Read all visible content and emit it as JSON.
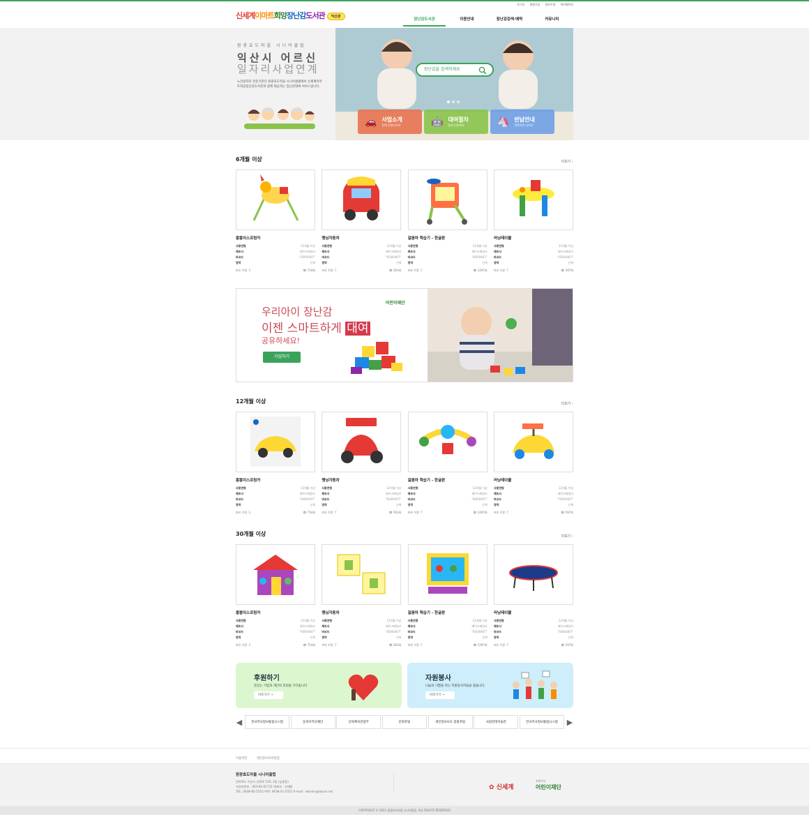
{
  "util": [
    "로그인",
    "회원가입",
    "정보수정",
    "마이페이지"
  ],
  "logo": {
    "text1": "신세계",
    "text2": "이마트",
    "text3": "희망",
    "text4": "장난감",
    "text5": "도서관",
    "badge": "익산관"
  },
  "gnb": [
    "장난감도서관",
    "이용안내",
    "장난감검색·예약",
    "커뮤니티"
  ],
  "hero": {
    "sub": "원광효도마을 시니어클럽",
    "title1": "익산시 어르신",
    "title2": "일자리사업연계",
    "desc": "노인일자리 전문기관인 원광효도마을 시니어클럽에서 신세계이마트희망장난감도서관과 함께 제공하는 장난감대여 서비스입니다.",
    "search_placeholder": "장난감을 검색하세요",
    "btns": [
      {
        "label": "사업소개",
        "sub": "함께 만들어가요",
        "icon": "🚗"
      },
      {
        "label": "대여절차",
        "sub": "쉽게 대여해요",
        "icon": "🤖"
      },
      {
        "label": "반납안내",
        "sub": "정확하게 지켜요",
        "icon": "🦄"
      }
    ]
  },
  "sections": [
    {
      "title": "6개월 이상",
      "more": "더보기 ›"
    },
    {
      "title": "12개월 이상",
      "more": "더보기 ›"
    },
    {
      "title": "30개월 이상",
      "more": "더보기 ›"
    }
  ],
  "labels": {
    "age": "사용연령",
    "maker": "제조사",
    "barcode": "바코드",
    "area": "영역",
    "holdings": "보유 수량 :"
  },
  "products": [
    {
      "name": "뽕뽕이스프링카",
      "age": "12개월 이상",
      "maker": "베이크베일리",
      "barcode": "\"IS000467\"",
      "area": "신체",
      "qty": "3",
      "views": "754회"
    },
    {
      "name": "맹닝자동차",
      "age": "12개월 이상",
      "maker": "베이크베일리",
      "barcode": "\"IS000467\"",
      "area": "신체",
      "qty": "7",
      "views": "561회"
    },
    {
      "name": "걸음마 학습기 - 한글판",
      "age": "12개월 이상",
      "maker": "베이크베일리",
      "barcode": "\"IS000467\"",
      "area": "신체",
      "qty": "7",
      "views": "1297회"
    },
    {
      "name": "러닝테이블",
      "age": "12개월 이상",
      "maker": "베이크베일리",
      "barcode": "\"IS000467\"",
      "area": "신체",
      "qty": "7",
      "views": "597회"
    }
  ],
  "banner": {
    "t1": "우리아이 장난감",
    "t2a": "이젠 스마트하게 ",
    "t2b": "대여",
    "t3": "공유하세요!",
    "btn": "가입하기",
    "logo": "어린이재단"
  },
  "promo": [
    {
      "title": "후원하기",
      "desc": "뜻있는 기업과 개인의 후원을 기다립니다.",
      "btn": "바로가기"
    },
    {
      "title": "자원봉사",
      "desc": "나눔의 기쁨을 아는 자원봉사자들을 찾습니다.",
      "btn": "바로가기"
    }
  ],
  "partners": [
    "한국역사정보통합시스템",
    "동북아역사재단",
    "문화체육관광부",
    "문화포털",
    "개인정보보호 종합포털",
    "국립현대미술관",
    "한국역사정보통합시스템"
  ],
  "fnav": [
    "이용약관",
    "개인정보처리방침"
  ],
  "footer": {
    "name": "원광효도마을 시니어클럽",
    "addr": "전라북도 익산시 선화로 159, 2층 (남중동)",
    "biz": "사업자번호 : 403-82-61731      대표자 : 신재원",
    "tel": "TEL: 0638-82-5552      FAX: 0638-41-5551      E-mail : wknoin@daum.net",
    "logo1": "신세계",
    "logo2_sub": "초록우산",
    "logo2": "어린이재단",
    "copy": "COPYRIGHT © 2021 원광효도마을 시니어클럽. ALL RIGHTS RESERVED"
  }
}
